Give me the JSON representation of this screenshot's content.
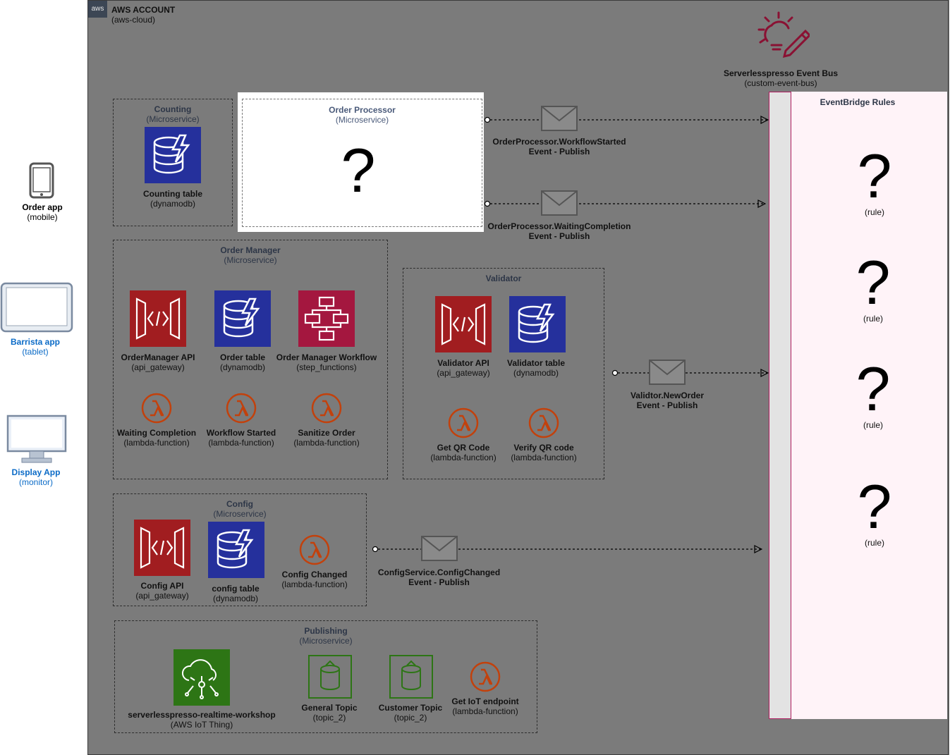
{
  "account": {
    "title": "AWS ACCOUNT",
    "subtitle": "(aws-cloud)",
    "badge": "aws"
  },
  "devices": [
    {
      "name": "Order app",
      "type": "(mobile)",
      "icon": "mobile-phone-icon"
    },
    {
      "name": "Barrista app",
      "type": "(tablet)",
      "icon": "tablet-icon"
    },
    {
      "name": "Display App",
      "type": "(monitor)",
      "icon": "monitor-icon"
    }
  ],
  "event_bus": {
    "name": "Serverlesspresso Event Bus",
    "type": "(custom-event-bus)",
    "icon": "eventbridge-bus-icon",
    "color": "#8a1133"
  },
  "rules_panel": {
    "title": "EventBridge Rules",
    "rule_label": "(rule)",
    "question": "?"
  },
  "order_processor": {
    "title": "Order Processor",
    "subtitle": "(Microservice)",
    "question": "?"
  },
  "counting": {
    "title": "Counting",
    "subtitle": "(Microservice)",
    "table": {
      "name": "Counting table",
      "type": "(dynamodb)"
    }
  },
  "order_manager": {
    "title": "Order Manager",
    "subtitle": "(Microservice)",
    "items": [
      {
        "name": "OrderManager API",
        "type": "(api_gateway)"
      },
      {
        "name": "Order table",
        "type": "(dynamodb)"
      },
      {
        "name": "Order Manager Workflow",
        "type": "(step_functions)"
      },
      {
        "name": "Waiting Completion",
        "type": "(lambda-function)"
      },
      {
        "name": "Workflow Started",
        "type": "(lambda-function)"
      },
      {
        "name": "Sanitize Order",
        "type": "(lambda-function)"
      }
    ]
  },
  "validator": {
    "title": "Validator",
    "items": [
      {
        "name": "Validator API",
        "type": "(api_gateway)"
      },
      {
        "name": "Validator table",
        "type": "(dynamodb)"
      },
      {
        "name": "Get QR Code",
        "type": "(lambda-function)"
      },
      {
        "name": "Verify QR code",
        "type": "(lambda-function)"
      }
    ]
  },
  "config": {
    "title": "Config",
    "subtitle": "(Microservice)",
    "items": [
      {
        "name": "Config API",
        "type": "(api_gateway)"
      },
      {
        "name": "config table",
        "type": "(dynamodb)"
      },
      {
        "name": "Config Changed",
        "type": "(lambda-function)"
      }
    ]
  },
  "publishing": {
    "title": "Publishing",
    "subtitle": "(Microservice)",
    "items": [
      {
        "name": "serverlesspresso-realtime-workshop",
        "type": "(AWS IoT Thing)"
      },
      {
        "name": "General Topic",
        "type": "(topic_2)"
      },
      {
        "name": "Customer Topic",
        "type": "(topic_2)"
      },
      {
        "name": "Get IoT endpoint",
        "type": "(lambda-function)"
      }
    ]
  },
  "events": [
    {
      "name": "OrderProcessor.WorkflowStarted",
      "action": "Event - Publish"
    },
    {
      "name": "OrderProcessor.WaitingCompletion",
      "action": "Event - Publish"
    },
    {
      "name": "Validtor.NewOrder",
      "action": "Event - Publish"
    },
    {
      "name": "ConfigService.ConfigChanged",
      "action": "Event - Publish"
    }
  ],
  "colors": {
    "api_gateway": "#a11d20",
    "dynamodb": "#25309c",
    "step_functions": "#a4173f",
    "lambda": "#c2410c",
    "iot": "#2d7515",
    "sns_topic": "#2d7515",
    "overlay": "#7b7b7b",
    "device_blue": "#0b6bc7"
  }
}
